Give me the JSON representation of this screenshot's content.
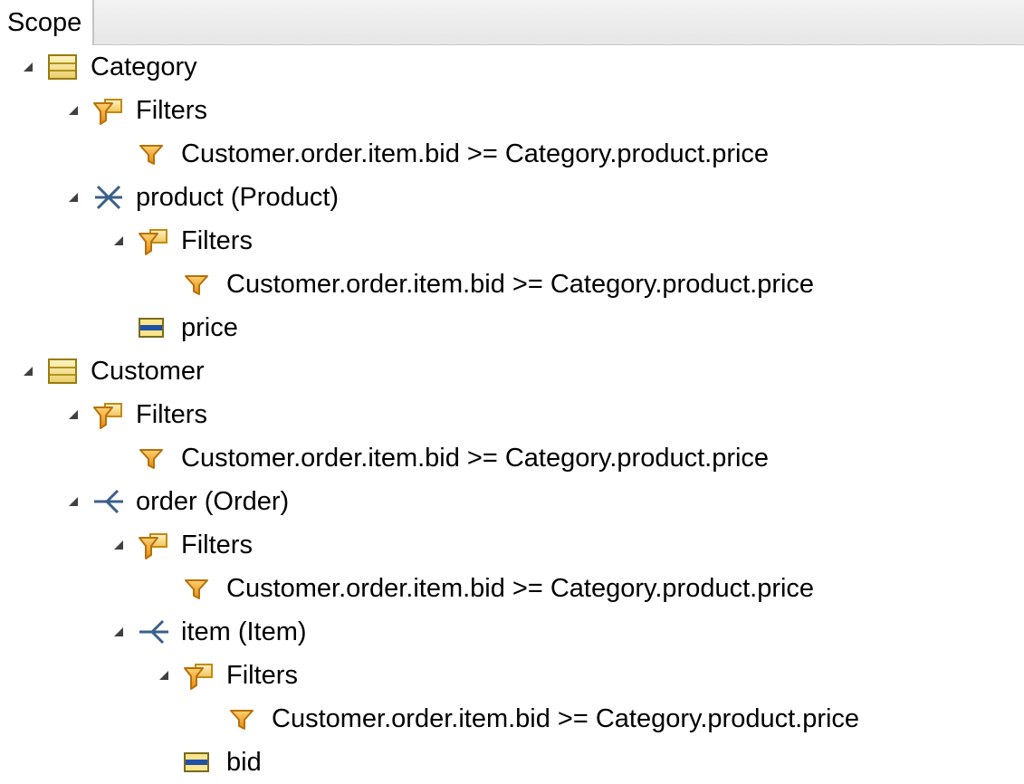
{
  "header": {
    "label": "Scope"
  },
  "tree": {
    "n1": {
      "label": "Category",
      "icon": "table-icon"
    },
    "n2": {
      "label": "Filters",
      "icon": "filters-folder-icon"
    },
    "n3": {
      "label": "Customer.order.item.bid >= Category.product.price",
      "icon": "filter-funnel-icon"
    },
    "n4": {
      "label": "product (Product)",
      "icon": "many-to-many-relation-icon"
    },
    "n5": {
      "label": "Filters",
      "icon": "filters-folder-icon"
    },
    "n6": {
      "label": "Customer.order.item.bid >= Category.product.price",
      "icon": "filter-funnel-icon"
    },
    "n7": {
      "label": "price",
      "icon": "column-icon"
    },
    "n8": {
      "label": "Customer",
      "icon": "table-icon"
    },
    "n9": {
      "label": "Filters",
      "icon": "filters-folder-icon"
    },
    "n10": {
      "label": "Customer.order.item.bid >= Category.product.price",
      "icon": "filter-funnel-icon"
    },
    "n11": {
      "label": "order (Order)",
      "icon": "one-to-many-relation-icon"
    },
    "n12": {
      "label": "Filters",
      "icon": "filters-folder-icon"
    },
    "n13": {
      "label": "Customer.order.item.bid >= Category.product.price",
      "icon": "filter-funnel-icon"
    },
    "n14": {
      "label": "item (Item)",
      "icon": "one-to-many-relation-icon"
    },
    "n15": {
      "label": "Filters",
      "icon": "filters-folder-icon"
    },
    "n16": {
      "label": "Customer.order.item.bid >= Category.product.price",
      "icon": "filter-funnel-icon"
    },
    "n17": {
      "label": "bid",
      "icon": "column-icon"
    }
  }
}
